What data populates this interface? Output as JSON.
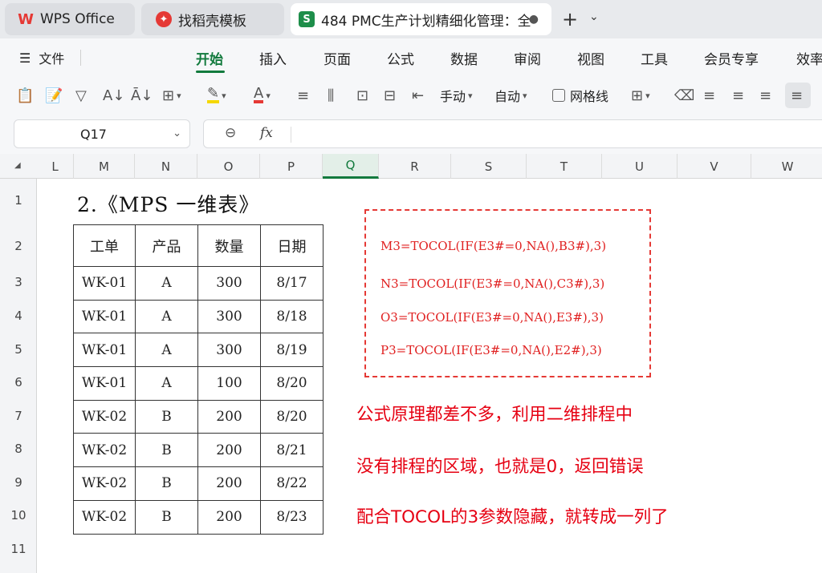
{
  "tabs": [
    {
      "label": "WPS Office",
      "icon": "wps-logo-icon"
    },
    {
      "label": "找稻壳模板",
      "icon": "docer-icon"
    },
    {
      "label": "484 PMC生产计划精细化管理：全",
      "icon": "spreadsheet-icon",
      "dirty_dot": "●",
      "icon_letter": "S"
    }
  ],
  "new_tab": "+",
  "menu": {
    "file": "文件",
    "items": [
      "开始",
      "插入",
      "页面",
      "公式",
      "数据",
      "审阅",
      "视图",
      "工具",
      "会员专享",
      "效率"
    ],
    "active": "开始"
  },
  "toolbar": {
    "manual_label": "手动",
    "auto_label": "自动",
    "gridlines_label": "网格线",
    "accent_green": "#127a3d",
    "highlight_color": "#f5d800",
    "font_color": "#e53935"
  },
  "formula_bar": {
    "cell_ref": "Q17",
    "fx": "fx",
    "content": ""
  },
  "columns": [
    "L",
    "M",
    "N",
    "O",
    "P",
    "Q",
    "R",
    "S",
    "T",
    "U",
    "V",
    "W"
  ],
  "selected_column": "Q",
  "rows": [
    "1",
    "2",
    "3",
    "4",
    "5",
    "6",
    "7",
    "8",
    "9",
    "10",
    "11"
  ],
  "sheet": {
    "heading": "2.《MPS 一维表》",
    "table": {
      "headers": [
        "工单",
        "产品",
        "数量",
        "日期"
      ],
      "rows": [
        [
          "WK-01",
          "A",
          "300",
          "8/17"
        ],
        [
          "WK-01",
          "A",
          "300",
          "8/18"
        ],
        [
          "WK-01",
          "A",
          "300",
          "8/19"
        ],
        [
          "WK-01",
          "A",
          "100",
          "8/20"
        ],
        [
          "WK-02",
          "B",
          "200",
          "8/20"
        ],
        [
          "WK-02",
          "B",
          "200",
          "8/21"
        ],
        [
          "WK-02",
          "B",
          "200",
          "8/22"
        ],
        [
          "WK-02",
          "B",
          "200",
          "8/23"
        ]
      ]
    },
    "formulas": [
      "M3=TOCOL(IF(E3#=0,NA(),B3#),3)",
      "N3=TOCOL(IF(E3#=0,NA(),C3#),3)",
      "O3=TOCOL(IF(E3#=0,NA(),E3#),3)",
      "P3=TOCOL(IF(E3#=0,NA(),E2#),3)"
    ],
    "notes": [
      "公式原理都差不多，利用二维排程中",
      "没有排程的区域，也就是0，返回错误",
      "配合TOCOL的3参数隐藏，就转成一列了"
    ],
    "note_color": "#e60012"
  }
}
